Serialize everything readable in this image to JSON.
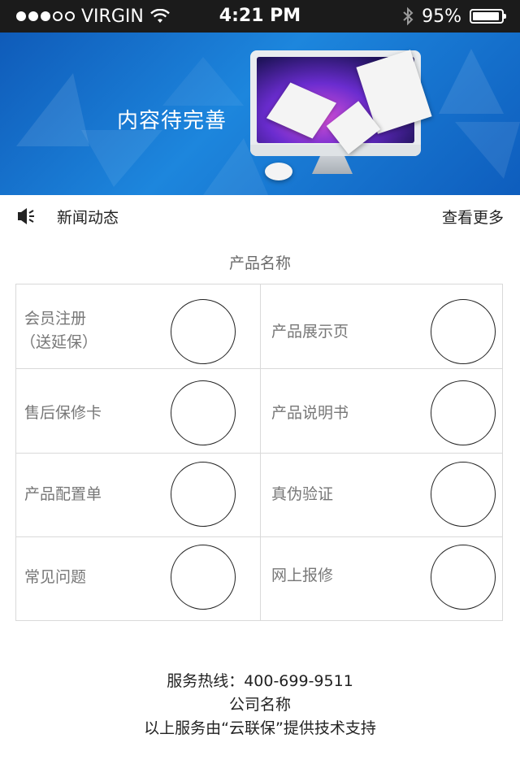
{
  "status_bar": {
    "carrier": "VIRGIN",
    "time": "4:21 PM",
    "battery_percent": "95%",
    "battery_level": 0.95,
    "signal_bars_filled": 3,
    "signal_bars_total": 5
  },
  "banner": {
    "text": "内容待完善"
  },
  "news": {
    "title": "新闻动态",
    "more": "查看更多"
  },
  "products": {
    "title": "产品名称",
    "items": [
      {
        "label": "会员注册",
        "sublabel": "（送延保）"
      },
      {
        "label": "产品展示页"
      },
      {
        "label": "售后保修卡"
      },
      {
        "label": "产品说明书"
      },
      {
        "label": "产品配置单"
      },
      {
        "label": "真伪验证"
      },
      {
        "label": "常见问题"
      },
      {
        "label": "网上报修"
      }
    ]
  },
  "footer": {
    "hotline": "服务热线：400-699-9511",
    "company": "公司名称",
    "support": "以上服务由“云联保”提供技术支持"
  }
}
